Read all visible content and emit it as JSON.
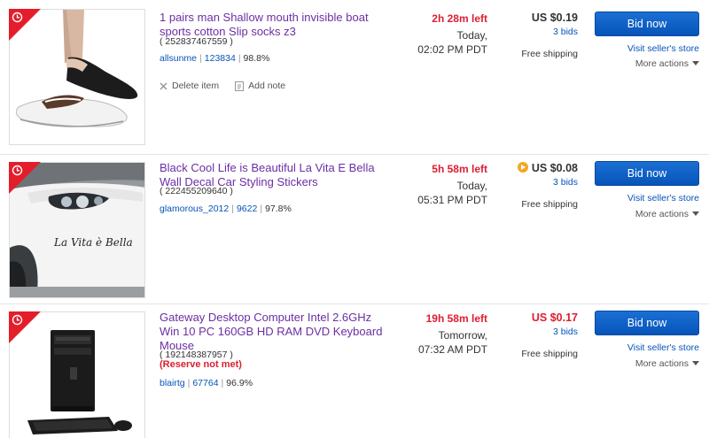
{
  "items": [
    {
      "title": "1 pairs man Shallow mouth invisible boat sports cotton Slip socks z3",
      "item_number": "( 252837467559 )",
      "seller": {
        "name": "allsunme",
        "feedback": "123834",
        "percent": "98.8%"
      },
      "time_left": "2h 28m left",
      "end_date_line1": "Today,",
      "end_date_line2": "02:02 PM PDT",
      "price": "US $0.19",
      "bids": "3 bids",
      "shipping": "Free shipping",
      "bid_label": "Bid now",
      "store_label": "Visit seller's store",
      "more_label": "More actions",
      "delete_label": "Delete item",
      "note_label": "Add note"
    },
    {
      "title": "Black Cool Life is Beautiful La Vita E Bella Wall Decal Car Styling Stickers",
      "item_number": "( 222455209640 )",
      "seller": {
        "name": "glamorous_2012",
        "feedback": "9622",
        "percent": "97.8%"
      },
      "time_left": "5h 58m left",
      "end_date_line1": "Today,",
      "end_date_line2": "05:31 PM PDT",
      "price": "US $0.08",
      "bids": "3 bids",
      "shipping": "Free shipping",
      "bid_label": "Bid now",
      "store_label": "Visit seller's store",
      "more_label": "More actions",
      "decal_text": "La Vita è Bella"
    },
    {
      "title": "Gateway Desktop Computer Intel 2.6GHz Win 10 PC 160GB HD RAM DVD Keyboard Mouse",
      "item_number": "( 192148387957 )",
      "reserve": "(Reserve not met)",
      "seller": {
        "name": "blairtg",
        "feedback": "67764",
        "percent": "96.9%"
      },
      "time_left": "19h 58m left",
      "end_date_line1": "Tomorrow,",
      "end_date_line2": "07:32 AM PDT",
      "price": "US $0.17",
      "bids": "3 bids",
      "shipping": "Free shipping",
      "bid_label": "Bid now",
      "store_label": "Visit seller's store",
      "more_label": "More actions"
    }
  ],
  "colors": {
    "accent_red": "#dd1e31",
    "link_blue": "#0654ba",
    "title_purple": "#6b2fa4",
    "button_blue": "#0654ba"
  }
}
